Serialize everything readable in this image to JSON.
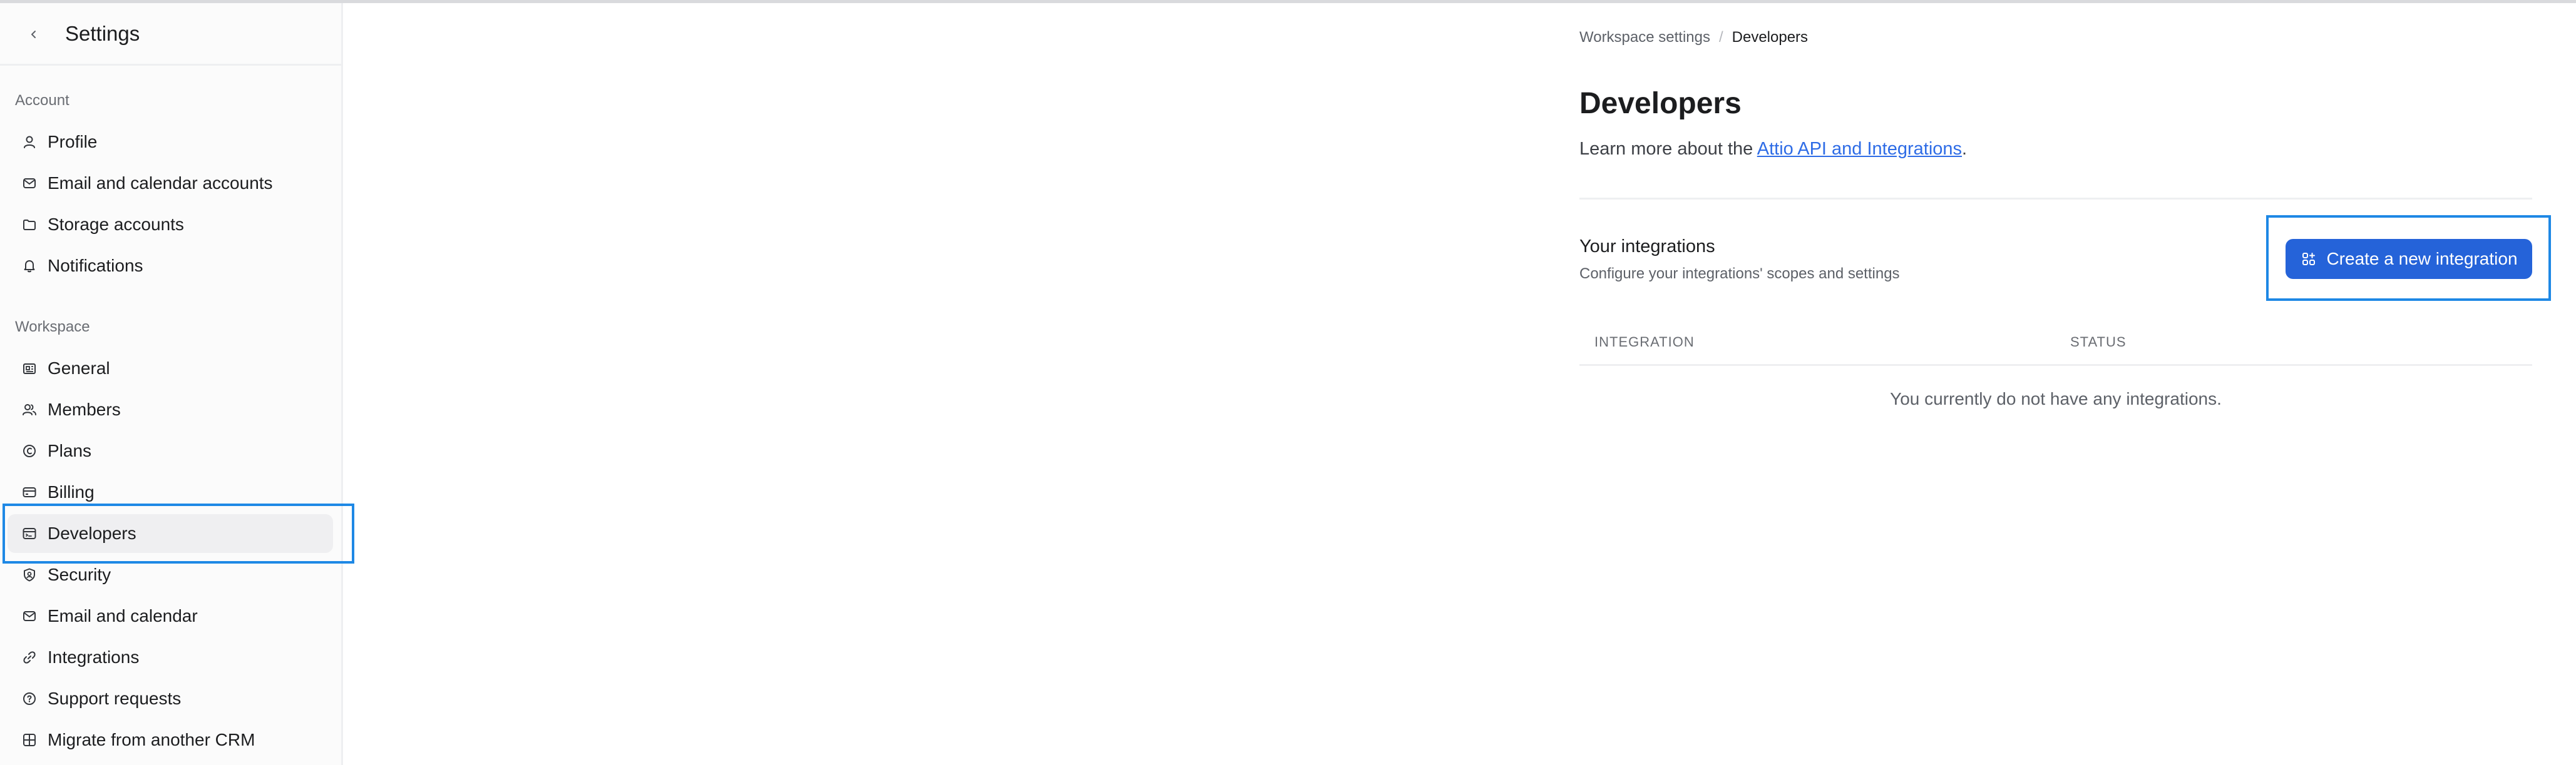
{
  "sidebar": {
    "title": "Settings",
    "account_section": "Account",
    "workspace_section": "Workspace",
    "account_items": [
      {
        "label": "Profile",
        "icon": "user-icon"
      },
      {
        "label": "Email and calendar accounts",
        "icon": "mail-icon"
      },
      {
        "label": "Storage accounts",
        "icon": "folder-icon"
      },
      {
        "label": "Notifications",
        "icon": "bell-icon"
      }
    ],
    "workspace_items": [
      {
        "label": "General",
        "icon": "building-icon"
      },
      {
        "label": "Members",
        "icon": "users-icon"
      },
      {
        "label": "Plans",
        "icon": "plan-coin-icon"
      },
      {
        "label": "Billing",
        "icon": "credit-card-icon"
      },
      {
        "label": "Developers",
        "icon": "code-window-icon",
        "active": true
      },
      {
        "label": "Security",
        "icon": "shield-icon"
      },
      {
        "label": "Email and calendar",
        "icon": "mail-icon"
      },
      {
        "label": "Integrations",
        "icon": "link-icon"
      },
      {
        "label": "Support requests",
        "icon": "help-circle-icon"
      },
      {
        "label": "Migrate from another CRM",
        "icon": "grid-plus-icon"
      }
    ]
  },
  "breadcrumb": {
    "parent": "Workspace settings",
    "separator": "/",
    "current": "Developers"
  },
  "main": {
    "title": "Developers",
    "learn_prefix": "Learn more about the ",
    "learn_link": "Attio API and Integrations",
    "learn_suffix": ".",
    "integrations_title": "Your integrations",
    "integrations_subtitle": "Configure your integrations' scopes and settings",
    "create_button": "Create a new integration",
    "table": {
      "columns": [
        "INTEGRATION",
        "STATUS"
      ],
      "empty_message": "You currently do not have any integrations."
    }
  },
  "colors": {
    "accent": "#2563d9",
    "highlight": "#1e88e5",
    "active_bg": "#efeff1"
  }
}
